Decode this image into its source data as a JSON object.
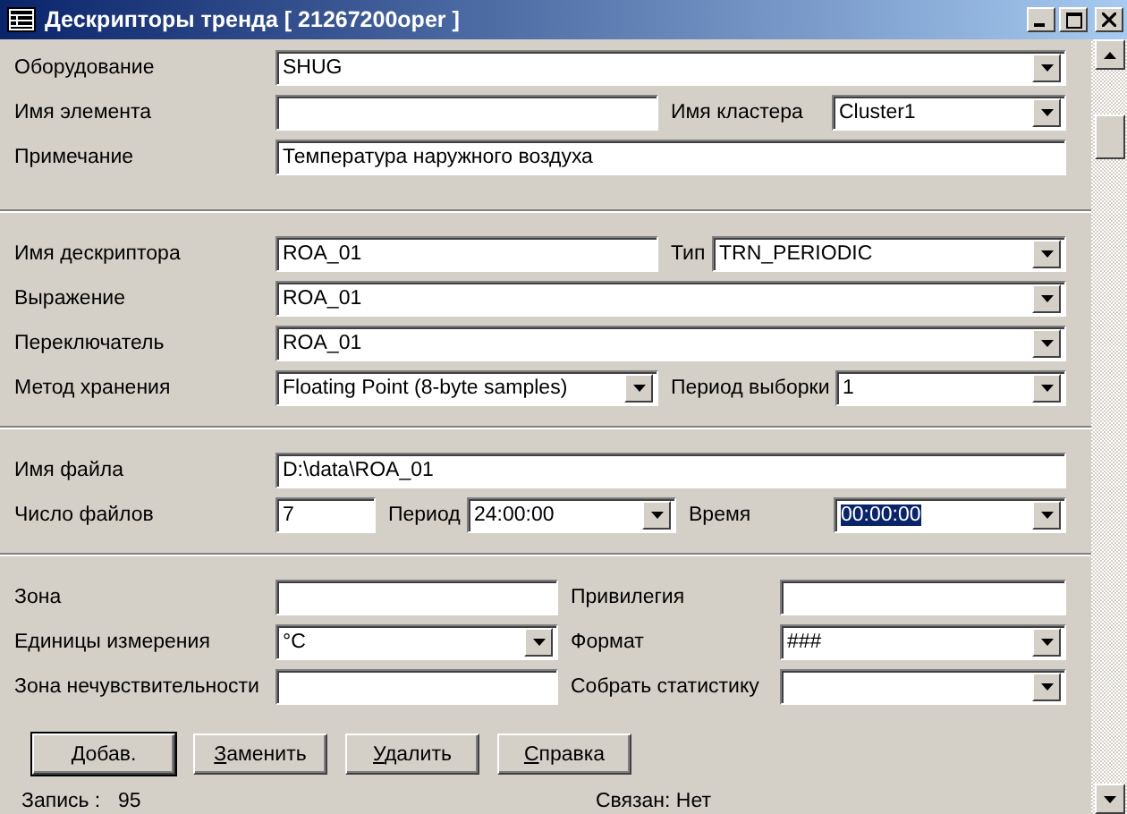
{
  "window": {
    "title": "Дескрипторы тренда [ 21267200oper ]"
  },
  "sections": [
    {
      "rows": [
        {
          "items": [
            {
              "kind": "label",
              "text": "Оборудование"
            },
            {
              "kind": "combo",
              "value": "SHUG",
              "highlighted": false
            }
          ]
        },
        {
          "items": [
            {
              "kind": "label",
              "text": "Имя элемента"
            },
            {
              "kind": "text"
            },
            {
              "kind": "label",
              "text": "Имя кластера"
            },
            {
              "kind": "combo",
              "value": "Cluster1",
              "highlighted": false
            }
          ]
        },
        {
          "items": [
            {
              "kind": "label",
              "text": "Примечание"
            },
            {
              "kind": "text",
              "value": "Температура наружного воздуха",
              "highlighted": false
            }
          ]
        }
      ]
    },
    {
      "rows": [
        {
          "items": [
            {
              "kind": "label",
              "text": "Имя дескриптора"
            },
            {
              "kind": "text",
              "value": "ROA_01",
              "highlighted": false
            },
            {
              "kind": "label",
              "text": "Тип"
            },
            {
              "kind": "combo",
              "value": "TRN_PERIODIC",
              "highlighted": false
            }
          ]
        },
        {
          "items": [
            {
              "kind": "label",
              "text": "Выражение"
            },
            {
              "kind": "combo",
              "value": "ROA_01",
              "highlighted": false
            }
          ]
        },
        {
          "items": [
            {
              "kind": "label",
              "text": "Переключатель"
            },
            {
              "kind": "combo",
              "value": "ROA_01",
              "highlighted": false
            }
          ]
        },
        {
          "items": [
            {
              "kind": "label",
              "text": "Метод хранения"
            },
            {
              "kind": "combo",
              "value": "Floating Point (8-byte samples)",
              "highlighted": false
            },
            {
              "kind": "label",
              "text": "Период выборки"
            },
            {
              "kind": "combo",
              "value": "1",
              "highlighted": false
            }
          ]
        }
      ]
    },
    {
      "rows": [
        {
          "items": [
            {
              "kind": "label",
              "text": "Имя файла"
            },
            {
              "kind": "text",
              "value": "D:\\data\\ROA_01",
              "highlighted": false
            }
          ]
        },
        {
          "items": [
            {
              "kind": "label",
              "text": "Число файлов"
            },
            {
              "kind": "text",
              "value": "7",
              "highlighted": false
            },
            {
              "kind": "label",
              "text": "Период"
            },
            {
              "kind": "combo",
              "value": "24:00:00",
              "highlighted": false
            },
            {
              "kind": "label",
              "text": "Время"
            },
            {
              "kind": "combo",
              "value": "00:00:00",
              "highlighted": true
            }
          ]
        }
      ]
    },
    {
      "rows": [
        {
          "items": [
            {
              "kind": "label",
              "text": "Зона"
            },
            {
              "kind": "text"
            },
            {
              "kind": "label",
              "text": "Привилегия"
            },
            {
              "kind": "text"
            }
          ]
        },
        {
          "items": [
            {
              "kind": "label",
              "text": "Единицы измерения"
            },
            {
              "kind": "combo",
              "value": "°C",
              "highlighted": false
            },
            {
              "kind": "label",
              "text": "Формат"
            },
            {
              "kind": "combo",
              "value": "###",
              "highlighted": false
            }
          ]
        },
        {
          "items": [
            {
              "kind": "label",
              "text": "Зона нечувствительности"
            },
            {
              "kind": "text"
            },
            {
              "kind": "label",
              "text": "Собрать статистику"
            },
            {
              "kind": "combo"
            }
          ]
        }
      ]
    }
  ],
  "buttons": [
    {
      "label": "Добав.",
      "default": true
    },
    {
      "label": "Заменить",
      "default": false
    },
    {
      "label": "Удалить",
      "default": false
    },
    {
      "label": "Справка",
      "default": false
    }
  ],
  "status": {
    "record_label": "Запись :",
    "record_value": "95",
    "link_status": "Связан: Нет"
  }
}
